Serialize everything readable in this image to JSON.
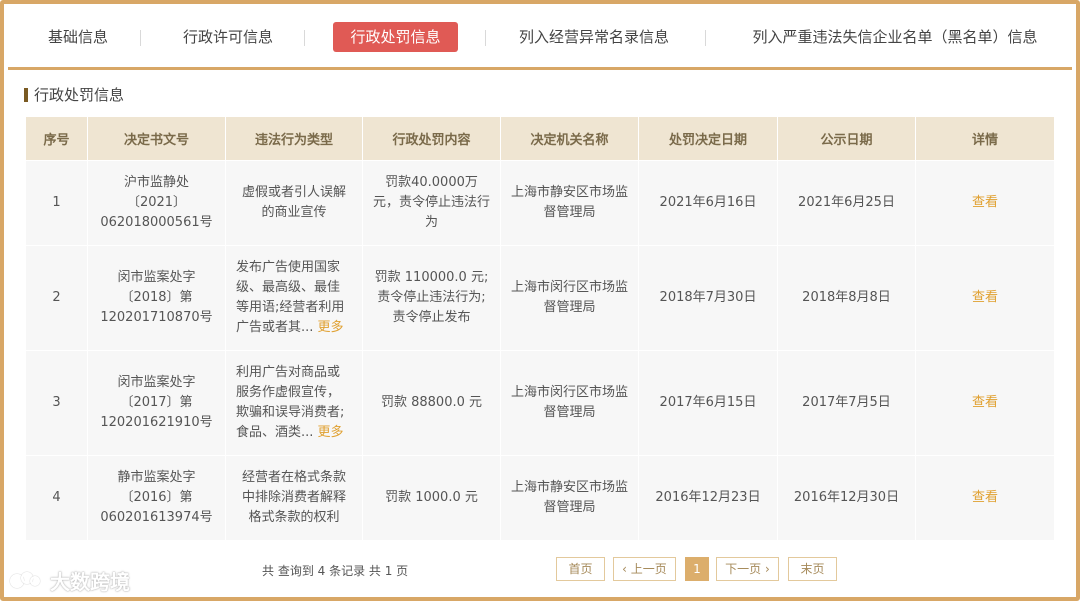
{
  "tabs": [
    {
      "label": "基础信息",
      "active": false
    },
    {
      "label": "行政许可信息",
      "active": false
    },
    {
      "label": "行政处罚信息",
      "active": true
    },
    {
      "label": "列入经营异常名录信息",
      "active": false
    },
    {
      "label": "列入严重违法失信企业名单（黑名单）信息",
      "active": false
    }
  ],
  "section_title": "行政处罚信息",
  "table": {
    "headers": [
      "序号",
      "决定书文号",
      "违法行为类型",
      "行政处罚内容",
      "决定机关名称",
      "处罚决定日期",
      "公示日期",
      "详情"
    ],
    "rows": [
      {
        "no": "1",
        "doc_no": "沪市监静处〔2021〕062018000561号",
        "type": "虚假或者引人误解的商业宣传",
        "type_more": "",
        "content": "罚款40.0000万元，责令停止违法行为",
        "authority": "上海市静安区市场监督管理局",
        "decision_date": "2021年6月16日",
        "publish_date": "2021年6月25日",
        "detail": "查看"
      },
      {
        "no": "2",
        "doc_no": "闵市监案处字〔2018〕第120201710870号",
        "type": "发布广告使用国家级、最高级、最佳等用语;经营者利用广告或者其...",
        "type_more": "更多",
        "content": "罚款 110000.0 元;责令停止违法行为;责令停止发布",
        "authority": "上海市闵行区市场监督管理局",
        "decision_date": "2018年7月30日",
        "publish_date": "2018年8月8日",
        "detail": "查看"
      },
      {
        "no": "3",
        "doc_no": "闵市监案处字〔2017〕第120201621910号",
        "type": "利用广告对商品或服务作虚假宣传，欺骗和误导消费者;食品、酒类...",
        "type_more": "更多",
        "content": "罚款 88800.0 元",
        "authority": "上海市闵行区市场监督管理局",
        "decision_date": "2017年6月15日",
        "publish_date": "2017年7月5日",
        "detail": "查看"
      },
      {
        "no": "4",
        "doc_no": "静市监案处字〔2016〕第060201613974号",
        "type": "经营者在格式条款中排除消费者解释格式条款的权利",
        "type_more": "",
        "content": "罚款 1000.0 元",
        "authority": "上海市静安区市场监督管理局",
        "decision_date": "2016年12月23日",
        "publish_date": "2016年12月30日",
        "detail": "查看"
      }
    ]
  },
  "summary": "共 查询到 4 条记录 共 1 页",
  "pagination": {
    "first": "首页",
    "prev": "上一页",
    "current": "1",
    "next": "下一页",
    "last": "末页"
  },
  "watermark": "大数跨境",
  "colors": {
    "accent": "#d8a766",
    "active_tab": "#e05a55",
    "header_bg": "#efe5d2",
    "link": "#e0a030"
  }
}
